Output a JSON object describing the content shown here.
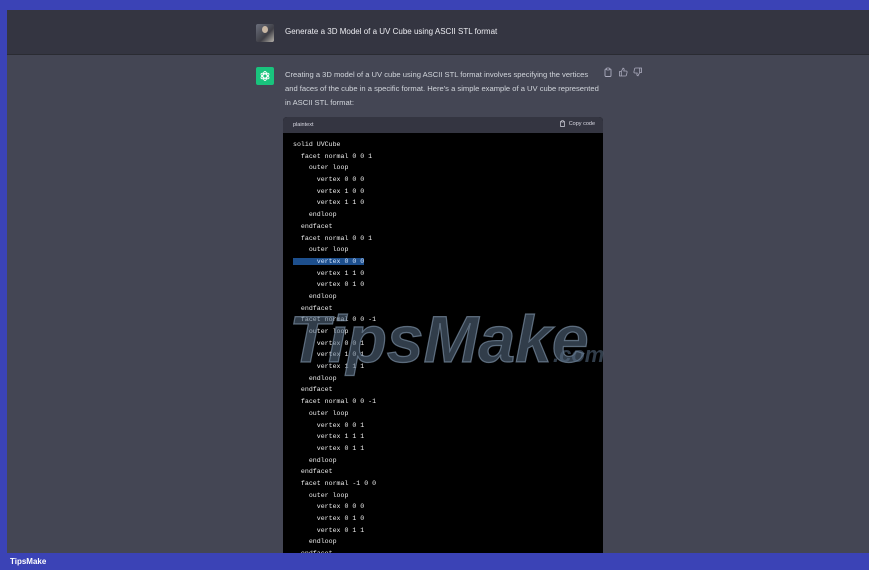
{
  "user_message": "Generate a 3D Model of a UV Cube using ASCII STL format",
  "assistant_intro": [
    "Creating a 3D model of a UV cube using ASCII STL format involves specifying the vertices",
    "and faces of the cube in a specific format. Here's a simple example of a UV cube represented",
    "in ASCII STL format:"
  ],
  "code_block": {
    "language": "plaintext",
    "copy_label": "Copy code",
    "lines": [
      "solid UVCube",
      "  facet normal 0 0 1",
      "    outer loop",
      "      vertex 0 0 0",
      "      vertex 1 0 0",
      "      vertex 1 1 0",
      "    endloop",
      "  endfacet",
      "  facet normal 0 0 1",
      "    outer loop",
      "      vertex 0 0 0",
      "      vertex 1 1 0",
      "      vertex 0 1 0",
      "    endloop",
      "  endfacet",
      "  facet normal 0 0 -1",
      "    outer loop",
      "      vertex 0 0 1",
      "      vertex 1 0 1",
      "      vertex 1 1 1",
      "    endloop",
      "  endfacet",
      "  facet normal 0 0 -1",
      "    outer loop",
      "      vertex 0 0 1",
      "      vertex 1 1 1",
      "      vertex 0 1 1",
      "    endloop",
      "  endfacet",
      "  facet normal -1 0 0",
      "    outer loop",
      "      vertex 0 0 0",
      "      vertex 0 1 0",
      "      vertex 0 1 1",
      "    endloop",
      "  endfacet"
    ]
  },
  "watermark": {
    "text": "TipsMake",
    "suffix": ".com"
  },
  "footer_label": "TipsMake",
  "colors": {
    "accent_green": "#19c37d",
    "highlight": "#1d4f8d",
    "frame_blue": "#3b43b6"
  },
  "icons": {
    "user_avatar": "user-photo",
    "assistant_avatar": "openai-logo-icon",
    "copy": "clipboard-icon",
    "thumbs_up": "thumbs-up-icon",
    "thumbs_down": "thumbs-down-icon"
  }
}
